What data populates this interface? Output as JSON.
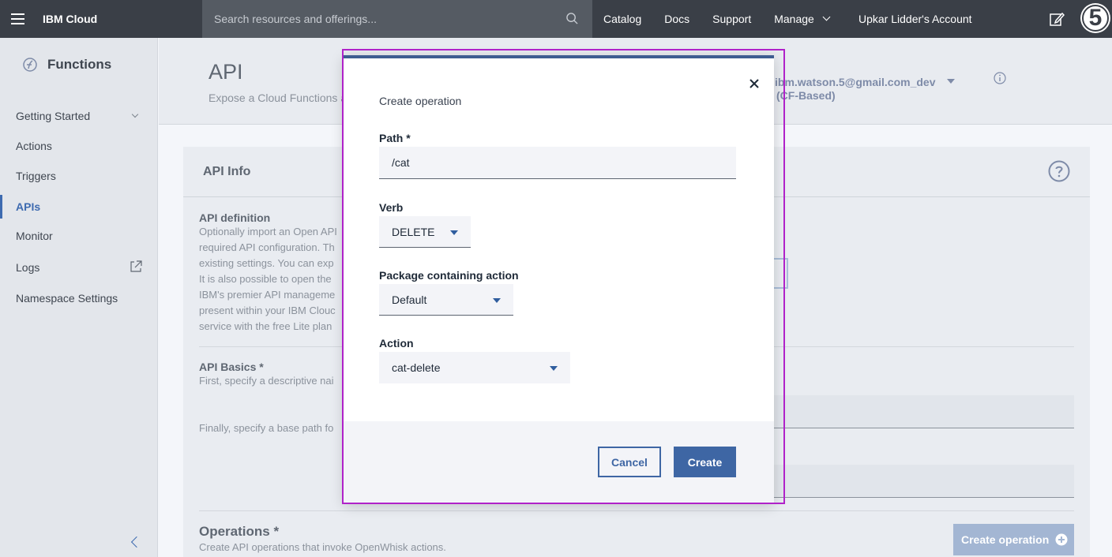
{
  "topbar": {
    "brand": "IBM Cloud",
    "search_placeholder": "Search resources and offerings...",
    "nav": [
      "Catalog",
      "Docs",
      "Support",
      "Manage"
    ],
    "account": "Upkar Lidder's Account",
    "avatar_badge": "5"
  },
  "sidebar": {
    "title": "Functions",
    "items": [
      {
        "label": "Getting Started"
      },
      {
        "label": "Actions"
      },
      {
        "label": "Triggers"
      },
      {
        "label": "APIs"
      },
      {
        "label": "Monitor"
      },
      {
        "label": "Logs"
      },
      {
        "label": "Namespace Settings"
      }
    ],
    "active_index": 3
  },
  "page": {
    "title": "API",
    "subtitle": "Expose a Cloud Functions a",
    "namespace_line1": "ibm.watson.5@gmail.com_dev",
    "namespace_line2": "(CF-Based)"
  },
  "card": {
    "title": "API Info",
    "definition_title": "API definition",
    "definition_text": [
      "Optionally import an Open API",
      "required API configuration. Th",
      "existing settings. You can exp",
      "It is also possible to open the",
      "IBM's premier API manageme",
      "present within your IBM Clouc",
      "service with the free Lite plan"
    ],
    "basics_title": "API Basics *",
    "basics_text": "First, specify a descriptive nai",
    "basepath_text": "Finally, specify a base path fo",
    "operations_title": "Operations *",
    "operations_sub": "Create API operations that invoke OpenWhisk actions.",
    "create_operation_label": "Create operation"
  },
  "modal": {
    "label": "Create operation",
    "path_label": "Path *",
    "path_value": "/cat",
    "verb_label": "Verb",
    "verb_value": "DELETE",
    "package_label": "Package containing action",
    "package_value": "Default",
    "action_label": "Action",
    "action_value": "cat-delete",
    "cancel_label": "Cancel",
    "create_label": "Create"
  },
  "colors": {
    "accent": "#3e66a4",
    "topbar": "#3a3f47",
    "highlight_outline": "#b022c9"
  }
}
